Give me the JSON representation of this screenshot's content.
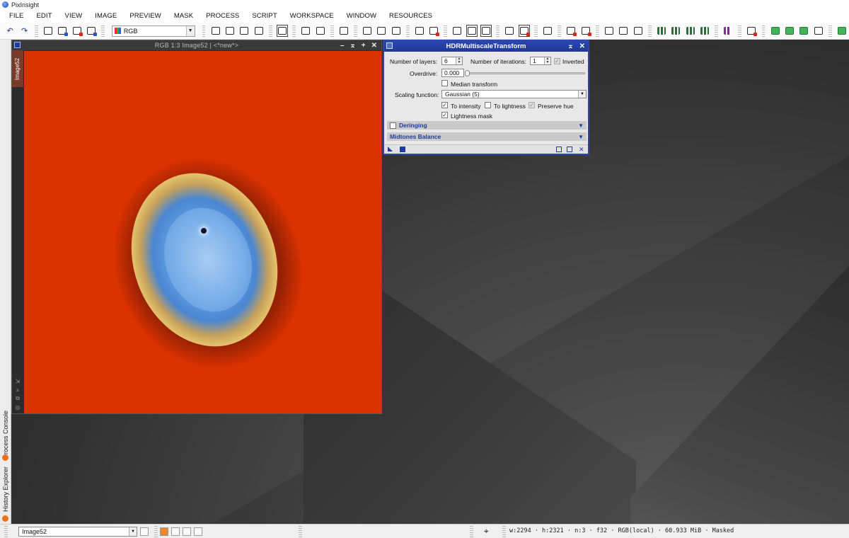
{
  "app": {
    "title": "PixInsight"
  },
  "menu": [
    "FILE",
    "EDIT",
    "VIEW",
    "IMAGE",
    "PREVIEW",
    "MASK",
    "PROCESS",
    "SCRIPT",
    "WORKSPACE",
    "WINDOW",
    "RESOURCES"
  ],
  "toolbar": {
    "channel_select": "RGB"
  },
  "image_window": {
    "title": "RGB 1:3 Image52 | <*new*>",
    "side_tab": "Image52",
    "background_color": "#dc3200"
  },
  "left_dock": {
    "tab_process_console": "Process Console",
    "tab_history_explorer": "History Explorer"
  },
  "process": {
    "title": "HDRMultiscaleTransform",
    "num_layers_label": "Number of layers:",
    "num_layers_value": "6",
    "num_iterations_label": "Number of iterations:",
    "num_iterations_value": "1",
    "inverted_label": "Inverted",
    "overdrive_label": "Overdrive:",
    "overdrive_value": "0.000",
    "median_transform_label": "Median transform",
    "scaling_function_label": "Scaling function:",
    "scaling_function_value": "Gaussian (5)",
    "to_intensity_label": "To intensity",
    "to_lightness_label": "To lightness",
    "preserve_hue_label": "Preserve hue",
    "lightness_mask_label": "Lightness mask",
    "section_deringing": "Deringing",
    "section_midtones": "Midtones Balance",
    "accent_color": "#2d46a8"
  },
  "statusbar": {
    "view_select": "Image52",
    "info": "w:2294 · h:2321 · n:3 · f32 · RGB(local) · 60.933 MiB · Masked"
  }
}
